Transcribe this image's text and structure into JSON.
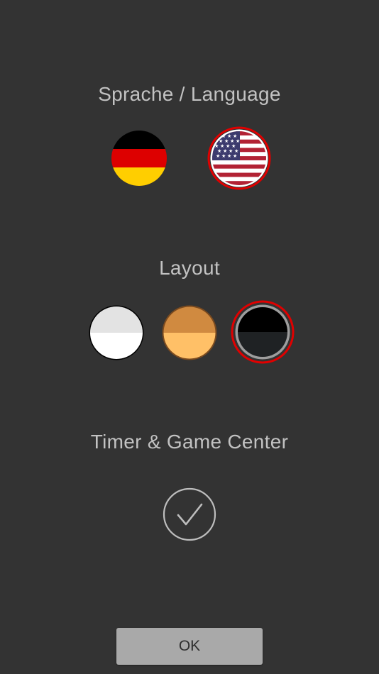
{
  "language": {
    "title": "Sprache / Language",
    "options": [
      {
        "name": "german-flag-icon",
        "selected": false
      },
      {
        "name": "us-flag-icon",
        "selected": true
      }
    ]
  },
  "layout": {
    "title": "Layout",
    "options": [
      {
        "name": "light-theme",
        "selected": false
      },
      {
        "name": "orange-theme",
        "selected": false
      },
      {
        "name": "dark-theme",
        "selected": true
      }
    ]
  },
  "timer": {
    "title": "Timer & Game Center",
    "enabled": true,
    "icon": "checkmark-icon"
  },
  "ok_button": {
    "label": "OK"
  },
  "colors": {
    "background": "#333333",
    "text": "#c2c2c2",
    "selection_ring": "#e00000",
    "button": "#a9a9a9"
  }
}
